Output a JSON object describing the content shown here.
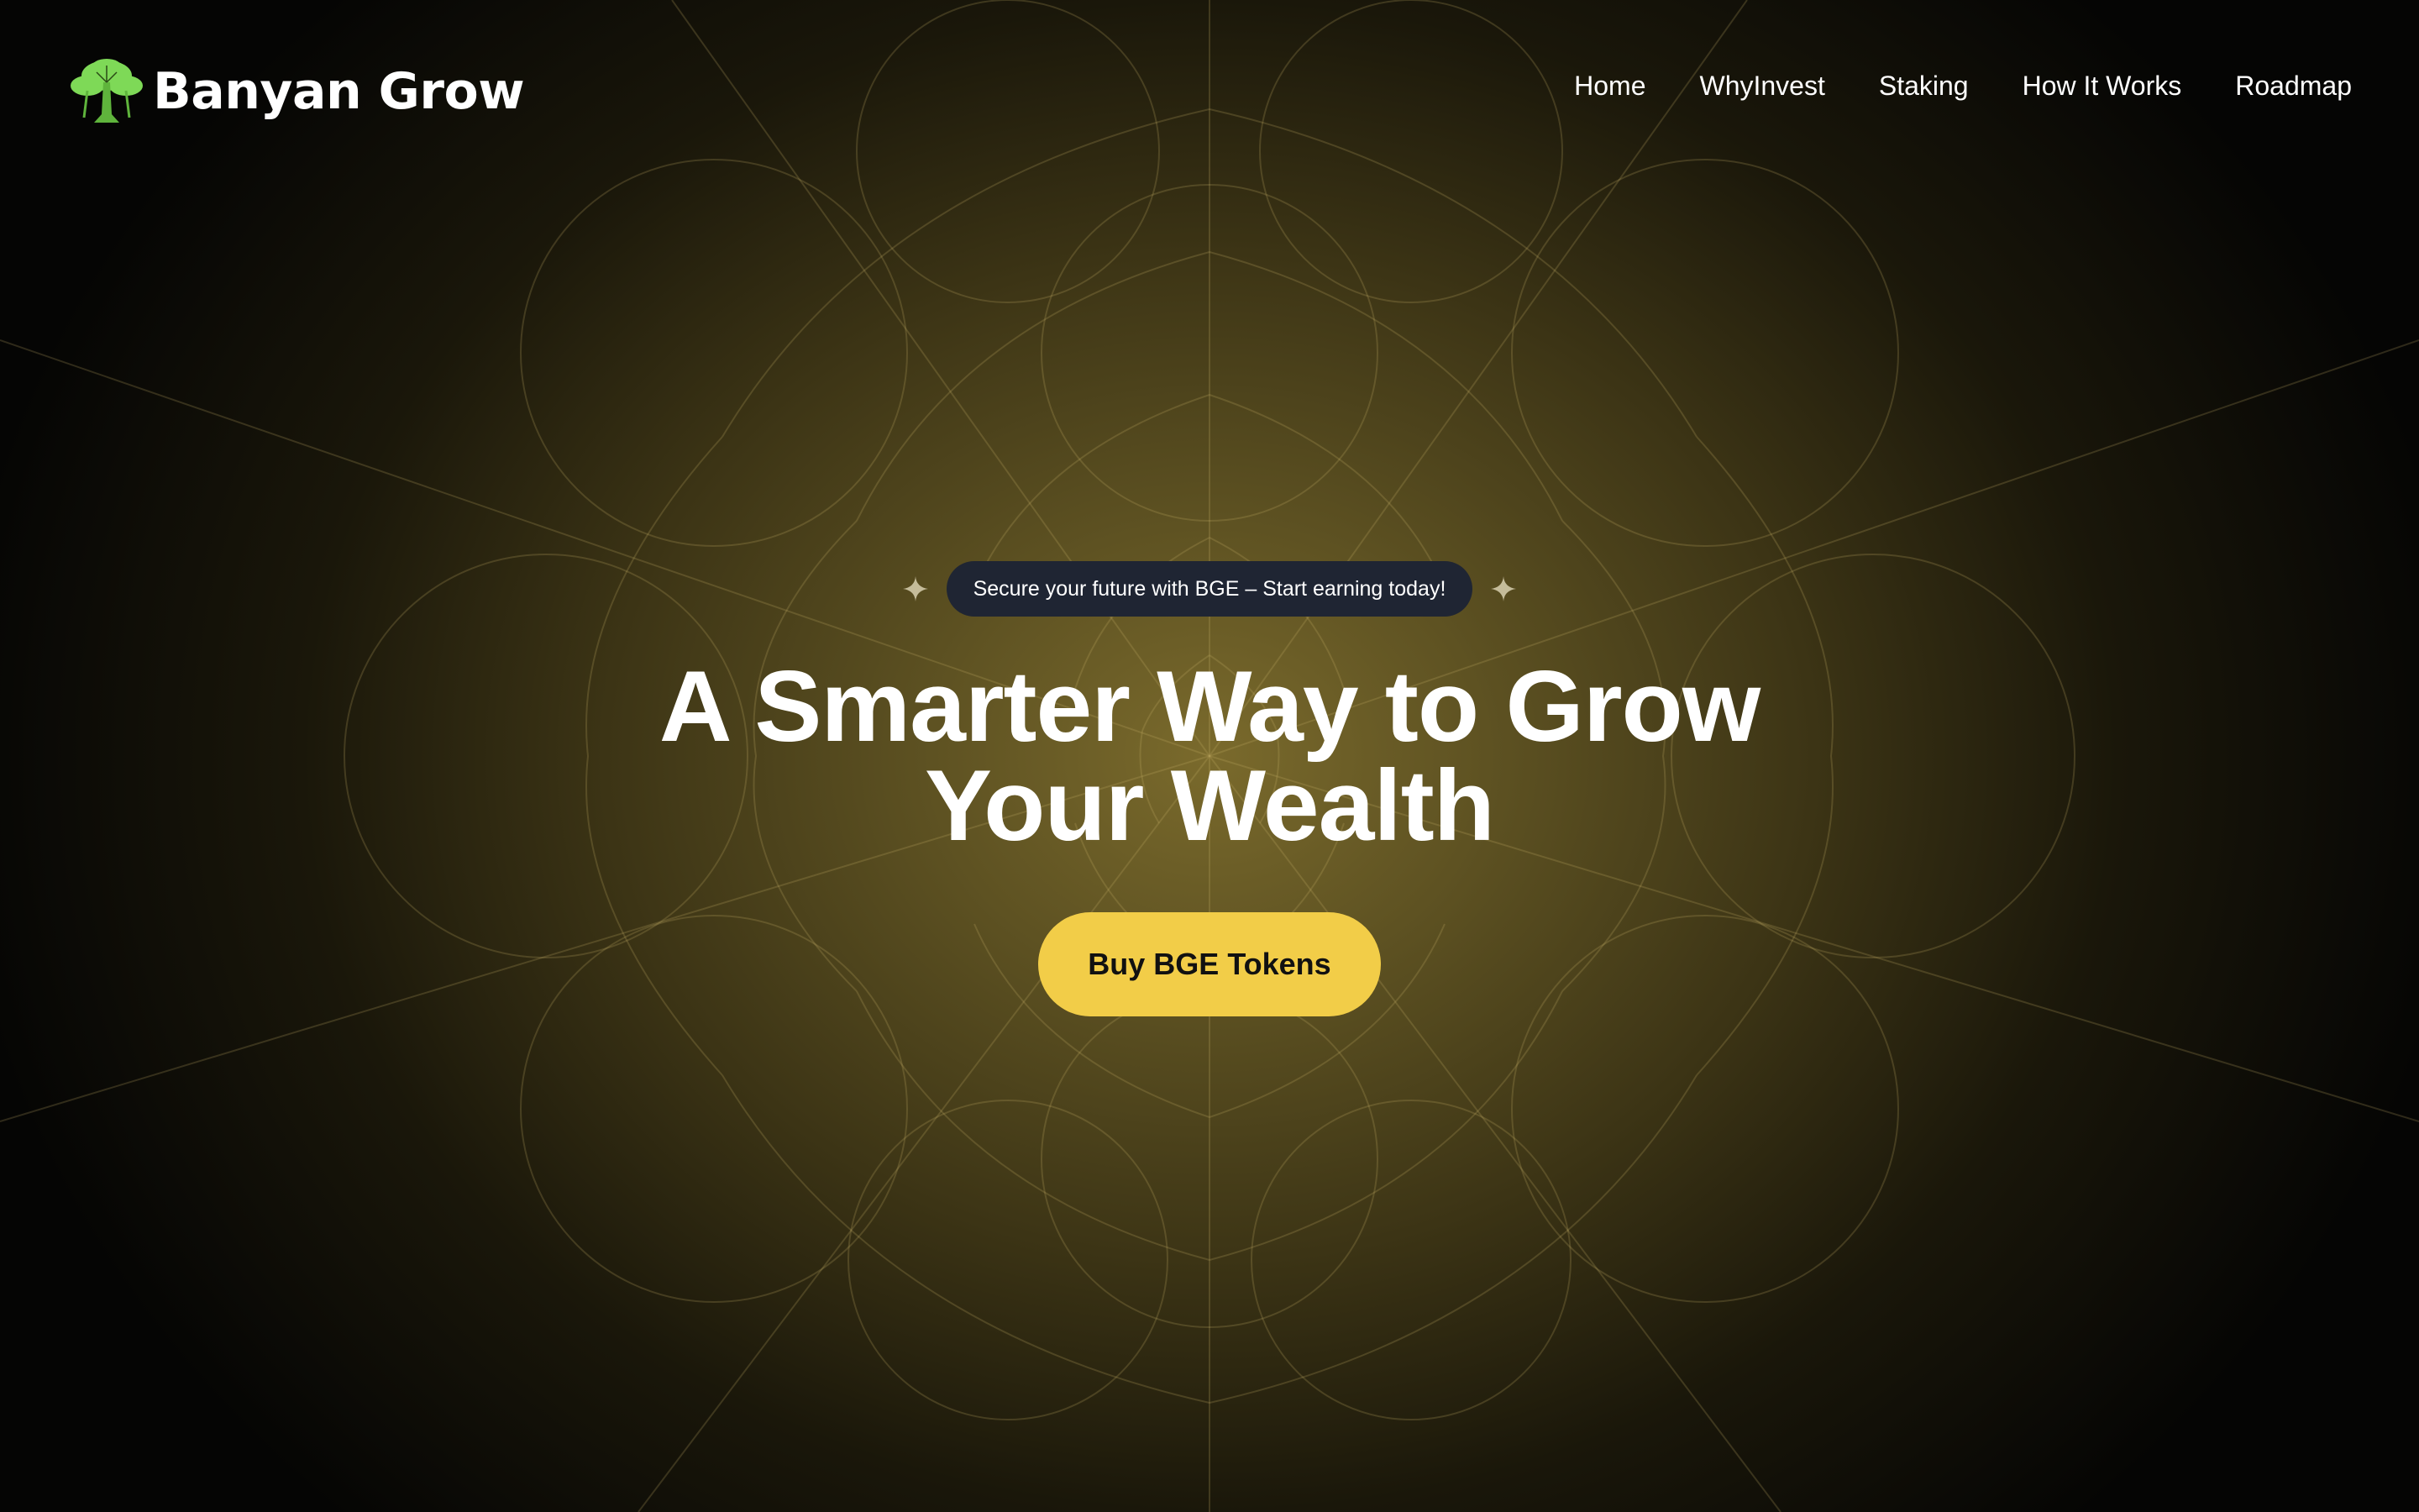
{
  "nav": {
    "brand": "Banyan Grow",
    "links": [
      "Home",
      "WhyInvest",
      "Staking",
      "How It Works",
      "Roadmap"
    ]
  },
  "hero": {
    "badge": "Secure your future with BGE – Start earning today!",
    "headline_line1": "A Smarter Way to Grow",
    "headline_line2": "Your Wealth",
    "cta_label": "Buy BGE Tokens"
  },
  "colors": {
    "accent_yellow": "#f2cd48",
    "badge_bg": "#1f2533",
    "logo_green": "#7ed957",
    "glow": "#7a6a2c",
    "background": "#000000"
  },
  "icons": {
    "logo": "banyan-tree-icon",
    "badge_decorations": "sparkle-icon"
  }
}
